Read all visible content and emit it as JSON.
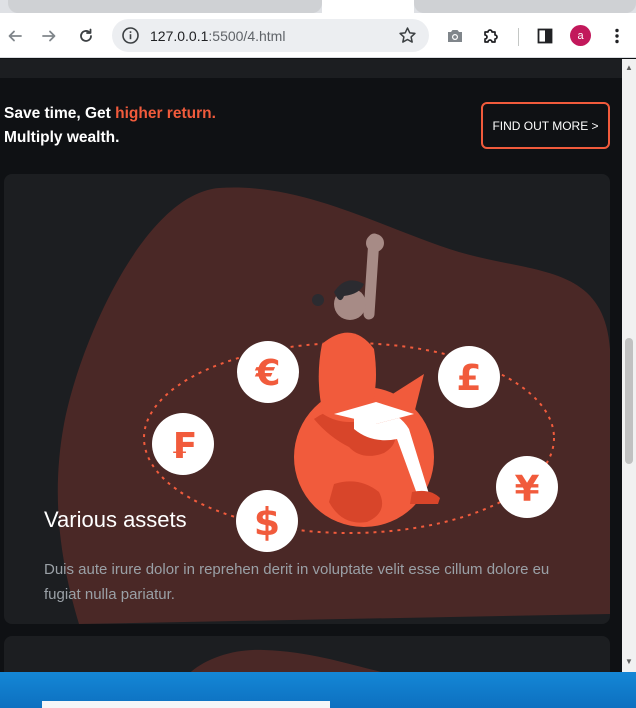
{
  "browser": {
    "url_host": "127.0.0.1",
    "url_path": ":5500/4.html",
    "avatar_letter": "a",
    "icons": [
      "back-arrow-icon",
      "forward-arrow-icon",
      "reload-icon",
      "info-icon",
      "star-icon",
      "camera-icon",
      "puzzle-extension-icon",
      "sidebar-icon",
      "kebab-menu-icon"
    ]
  },
  "promo": {
    "line1_prefix": "Save time, Get ",
    "line1_highlight": "higher return.",
    "line2": "Multiply wealth.",
    "cta_label": "FIND OUT MORE >"
  },
  "cards": [
    {
      "title": "Various assets",
      "description": "Duis aute irure dolor in reprehen derit in voluptate velit esse cillum dolore eu fugiat nulla pariatur.",
      "currency_icons": [
        "€",
        "£",
        "₣",
        "$",
        "¥"
      ]
    }
  ],
  "colors": {
    "accent": "#f15b3c",
    "page_bg": "#0f1114",
    "card_bg": "#1c1e21",
    "blob": "#4a2826",
    "avatar": "#c2185b"
  }
}
